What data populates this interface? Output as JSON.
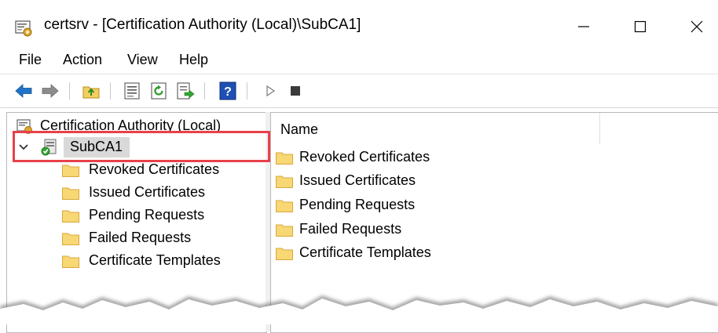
{
  "window": {
    "title": "certsrv - [Certification Authority (Local)\\SubCA1]"
  },
  "menu": [
    "File",
    "Action",
    "View",
    "Help"
  ],
  "toolbar": {
    "icons": [
      "back-icon",
      "forward-icon",
      "up-folder-icon",
      "properties-icon",
      "refresh-icon",
      "export-list-icon",
      "help-icon",
      "play-icon",
      "stop-icon"
    ]
  },
  "tree": {
    "root_label": "Certification Authority (Local)",
    "ca_label": "SubCA1",
    "children": [
      "Revoked Certificates",
      "Issued Certificates",
      "Pending Requests",
      "Failed Requests",
      "Certificate Templates"
    ]
  },
  "list": {
    "column_name": "Name",
    "items": [
      "Revoked Certificates",
      "Issued Certificates",
      "Pending Requests",
      "Failed Requests",
      "Certificate Templates"
    ]
  },
  "colors": {
    "highlight_border": "#e8414a",
    "folder_fill": "#f8d775",
    "folder_edge": "#d9a93a",
    "selection_bg": "#d9d9d9"
  }
}
